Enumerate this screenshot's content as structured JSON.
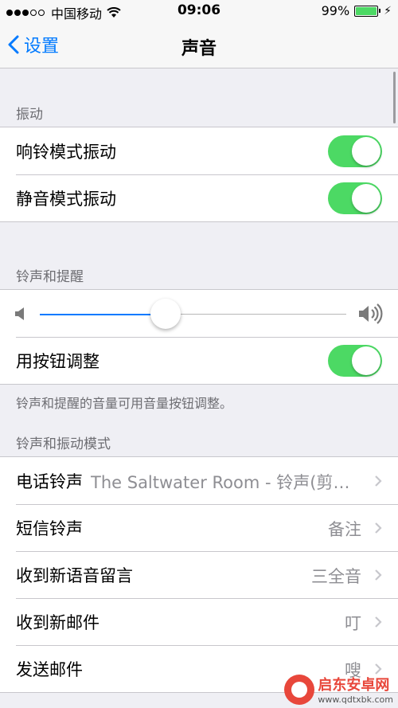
{
  "status_bar": {
    "carrier": "中国移动",
    "time": "09:06",
    "battery_percent": "99%",
    "battery_level": 0.99,
    "signal_bars_filled": 3,
    "signal_bars_total": 5
  },
  "nav": {
    "back_label": "设置",
    "title": "声音"
  },
  "vibration": {
    "header": "振动",
    "ring_vibrate_label": "响铃模式振动",
    "ring_vibrate_on": true,
    "silent_vibrate_label": "静音模式振动",
    "silent_vibrate_on": true
  },
  "ringer": {
    "header": "铃声和提醒",
    "volume_level": 0.41,
    "buttons_label": "用按钮调整",
    "buttons_on": true,
    "note": "铃声和提醒的音量可用音量按钮调整。"
  },
  "patterns": {
    "header": "铃声和振动模式",
    "items": [
      {
        "label": "电话铃声",
        "value": "The Saltwater Room - 铃声(剪辑版)"
      },
      {
        "label": "短信铃声",
        "value": "备注"
      },
      {
        "label": "收到新语音留言",
        "value": "三全音"
      },
      {
        "label": "收到新邮件",
        "value": "叮"
      },
      {
        "label": "发送邮件",
        "value": "嗖"
      }
    ]
  },
  "watermark": {
    "title": "启东安卓网",
    "url": "www.qdtxbk.com"
  },
  "colors": {
    "accent": "#007aff",
    "toggle_on": "#4cd964",
    "background": "#efeff4",
    "secondary_text": "#8e8e93"
  }
}
